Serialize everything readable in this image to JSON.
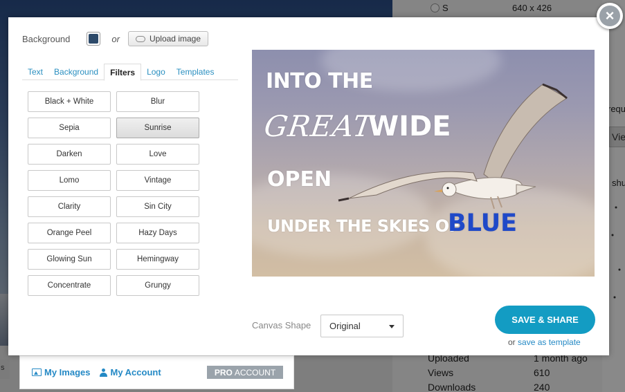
{
  "background_page": {
    "radio_label": "S",
    "dimension_text": "640 x 426",
    "fragment_requ": "requ",
    "fragment_view": "Vie",
    "fragment_shu": "shu",
    "stats": [
      {
        "key": "Uploaded",
        "value": "1 month ago"
      },
      {
        "key": "Views",
        "value": "610"
      },
      {
        "key": "Downloads",
        "value": "240"
      }
    ],
    "left_fragment": "s",
    "account_bar": {
      "my_images": "My Images",
      "my_account": "My Account",
      "pro_bold": "PRO",
      "pro_rest": "ACCOUNT"
    }
  },
  "modal": {
    "close_label": "×",
    "background_label": "Background",
    "background_color": "#2d4a6a",
    "or_label": "or",
    "upload_label": "Upload image",
    "tabs": [
      "Text",
      "Background",
      "Filters",
      "Logo",
      "Templates"
    ],
    "active_tab": "Filters",
    "filters": [
      "Black + White",
      "Blur",
      "Sepia",
      "Sunrise",
      "Darken",
      "Love",
      "Lomo",
      "Vintage",
      "Clarity",
      "Sin City",
      "Orange Peel",
      "Hazy Days",
      "Glowing Sun",
      "Hemingway",
      "Concentrate",
      "Grungy"
    ],
    "selected_filter": "Sunrise",
    "canvas_text": {
      "line1": "INTO THE",
      "line2a": "GREAT",
      "line2b": "WIDE",
      "line3": "OPEN",
      "line4a": "UNDER THE SKIES OF",
      "line4b": "BLUE"
    },
    "accent_blue": "#1f49c8",
    "canvas_shape_label": "Canvas Shape",
    "canvas_shape_value": "Original",
    "save_label": "SAVE & SHARE",
    "save_color": "#139cc3",
    "or_save_prefix": "or",
    "save_template_label": "save as template"
  }
}
